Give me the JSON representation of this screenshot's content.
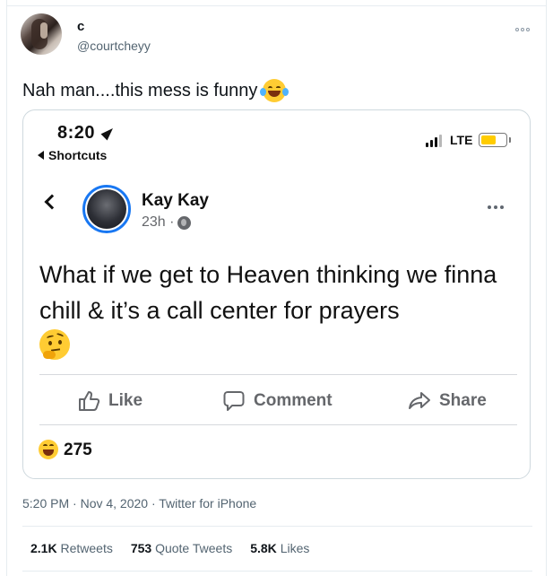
{
  "author": {
    "display_name": "c",
    "handle": "@courtcheyy"
  },
  "tweet": {
    "text": "Nah man....this mess is funny",
    "emoji": "face-with-tears-of-joy"
  },
  "embedded_screenshot": {
    "status_bar": {
      "time": "8:20",
      "back_app": "Shortcuts",
      "network": "LTE"
    },
    "post": {
      "author_name": "Kay Kay",
      "time_ago": "23h ·",
      "text": "What if we get to Heaven thinking we finna chill & it’s a call center for prayers",
      "emoji": "thinking-face"
    },
    "actions": {
      "like": "Like",
      "comment": "Comment",
      "share": "Share"
    },
    "reactions": {
      "count": "275",
      "emoji": "laughing-face"
    }
  },
  "footer": {
    "meta": "5:20 PM · Nov 4, 2020 · Twitter for iPhone",
    "retweets_count": "2.1K",
    "retweets_label": "Retweets",
    "quotes_count": "753",
    "quotes_label": "Quote Tweets",
    "likes_count": "5.8K",
    "likes_label": "Likes"
  },
  "colors": {
    "text_primary": "#0f1419",
    "text_secondary": "#536471",
    "facebook_blue": "#1877f2",
    "facebook_gray": "#65676b",
    "battery_yellow": "#ffcc00"
  }
}
